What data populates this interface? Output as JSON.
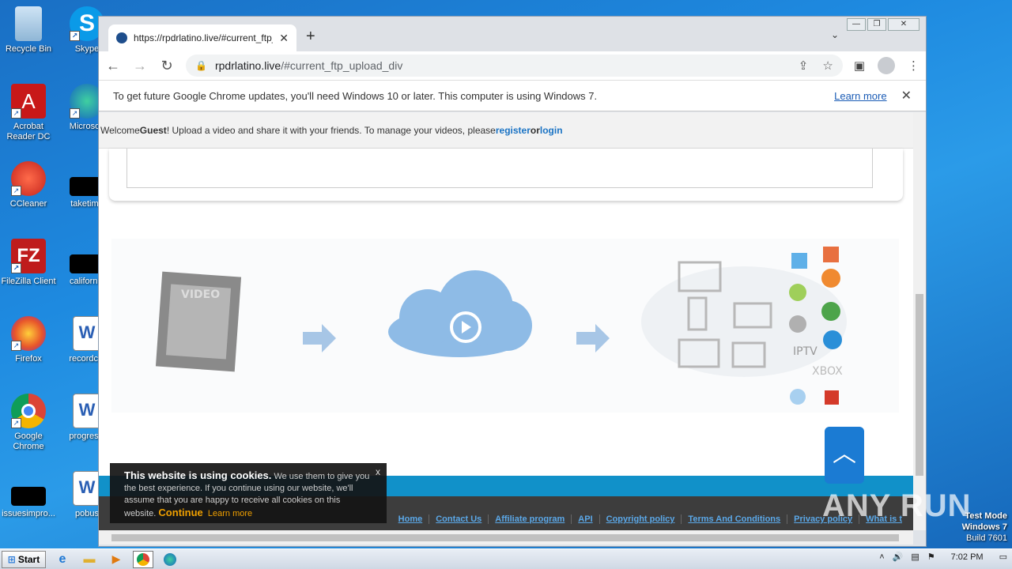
{
  "desktop": {
    "icons": [
      {
        "label": "Recycle Bin"
      },
      {
        "label": "Skype"
      },
      {
        "label": "Acrobat Reader DC"
      },
      {
        "label": "Microsoft"
      },
      {
        "label": "CCleaner"
      },
      {
        "label": "taketime"
      },
      {
        "label": "FileZilla Client"
      },
      {
        "label": "california"
      },
      {
        "label": "Firefox"
      },
      {
        "label": "recordclo"
      },
      {
        "label": "Google Chrome"
      },
      {
        "label": "progressi"
      },
      {
        "label": "issuesimpro..."
      },
      {
        "label": "pobus"
      }
    ]
  },
  "browser": {
    "tab_title": "https://rpdrlatino.live/#current_ftp_",
    "url_host": "rpdrlatino.live",
    "url_path": "/#current_ftp_upload_div",
    "infobar_text": "To get future Google Chrome updates, you'll need Windows 10 or later. This computer is using Windows 7.",
    "infobar_link": "Learn more"
  },
  "page": {
    "welcome_pre": "Welcome ",
    "welcome_guest": "Guest",
    "welcome_mid": "! Upload a video and share it with your friends. To manage your videos, please ",
    "register": "register",
    "or": " or ",
    "login": "login",
    "graphic": {
      "video_label": "VIDEO",
      "iptv_label": "IPTV",
      "xbox_label": "XBOX"
    },
    "footer_links": [
      "Home",
      "Contact Us",
      "Affiliate program",
      "API",
      "Copyright policy",
      "Terms And Conditions",
      "Privacy policy",
      "What is t"
    ],
    "cookie": {
      "title": "This website is using cookies.",
      "body": " We use them to give you the best experience. If you continue using our website, we'll assume that you are happy to receive all cookies on this website. ",
      "continue": "Continue",
      "learn_more": "Learn more",
      "close": "x"
    }
  },
  "taskbar": {
    "start": "Start",
    "clock": "7:02 PM"
  },
  "watermark": {
    "line1": "Test Mode",
    "line2": "Windows 7",
    "line3": "Build 7601",
    "brand": "ANY RUN"
  }
}
